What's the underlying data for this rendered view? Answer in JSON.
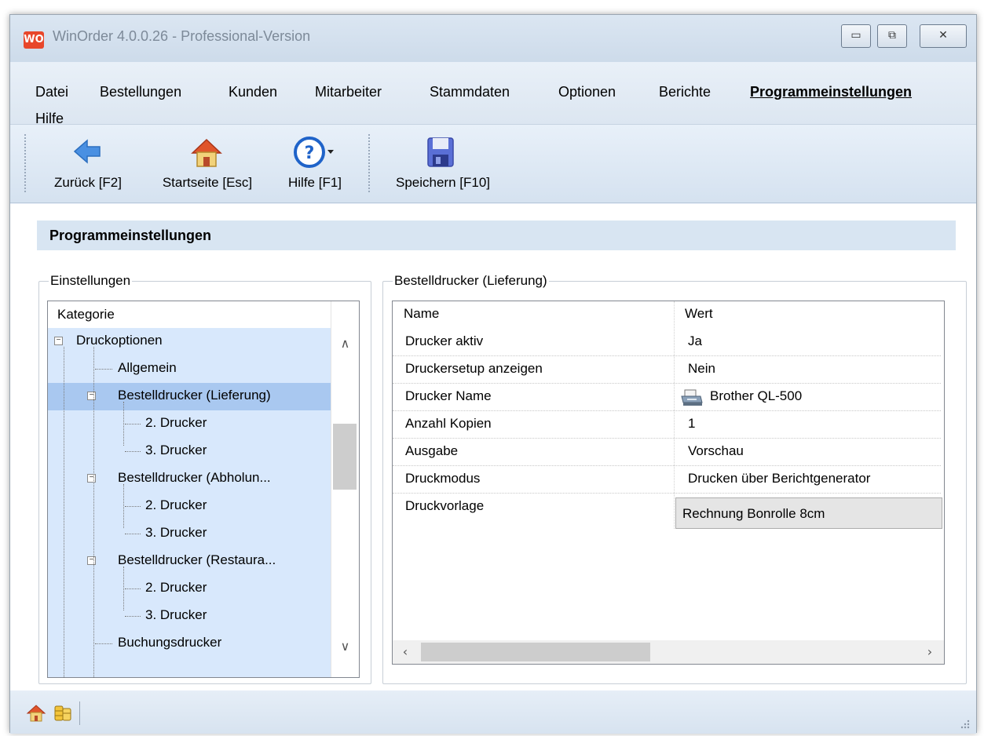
{
  "window": {
    "title": "WinOrder 4.0.0.26 - Professional-Version",
    "logo_text": "WO",
    "minimize_glyph": "▭",
    "maximize_glyph": "⧉",
    "close_glyph": "✕"
  },
  "menu": {
    "items": [
      "Datei",
      "Bestellungen",
      "Kunden",
      "Mitarbeiter",
      "Stammdaten",
      "Optionen",
      "Berichte",
      "Programmeinstellungen",
      "Hilfe"
    ],
    "active": "Programmeinstellungen"
  },
  "toolbar": {
    "back_label": "Zurück [F2]",
    "home_label": "Startseite [Esc]",
    "help_label": "Hilfe [F1]",
    "save_label": "Speichern [F10]"
  },
  "page": {
    "title": "Programmeinstellungen"
  },
  "settings": {
    "legend": "Einstellungen",
    "column_header": "Kategorie",
    "tree": [
      {
        "label": "Druckoptionen",
        "level": 0,
        "expander": "minus"
      },
      {
        "label": "Allgemein",
        "level": 1
      },
      {
        "label": "Bestelldrucker (Lieferung)",
        "level": 1,
        "expander": "minus",
        "selected": true
      },
      {
        "label": "2. Drucker",
        "level": 2
      },
      {
        "label": "3. Drucker",
        "level": 2
      },
      {
        "label": "Bestelldrucker (Abholun...",
        "level": 1,
        "expander": "minus"
      },
      {
        "label": "2. Drucker",
        "level": 2
      },
      {
        "label": "3. Drucker",
        "level": 2
      },
      {
        "label": "Bestelldrucker (Restaura...",
        "level": 1,
        "expander": "minus"
      },
      {
        "label": "2. Drucker",
        "level": 2
      },
      {
        "label": "3. Drucker",
        "level": 2
      },
      {
        "label": "Buchungsdrucker",
        "level": 1
      }
    ]
  },
  "properties": {
    "legend": "Bestelldrucker (Lieferung)",
    "headers": {
      "name": "Name",
      "value": "Wert"
    },
    "rows": [
      {
        "name": "Drucker aktiv",
        "value": "Ja"
      },
      {
        "name": "Druckersetup anzeigen",
        "value": "Nein"
      },
      {
        "name": "Drucker Name",
        "value": "Brother QL-500",
        "icon": "printer-icon"
      },
      {
        "name": "Anzahl Kopien",
        "value": "1"
      },
      {
        "name": "Ausgabe",
        "value": "Vorschau"
      },
      {
        "name": "Druckmodus",
        "value": "Drucken über Berichtgenerator"
      },
      {
        "name": "Druckvorlage",
        "value": "Rechnung Bonrolle 8cm",
        "editor": "combo"
      }
    ]
  },
  "colors": {
    "accent_selected": "#a9c8f0",
    "tree_highlight": "#d8e8fc",
    "header_band": "#d8e5f2",
    "logo": "#e8472b"
  }
}
